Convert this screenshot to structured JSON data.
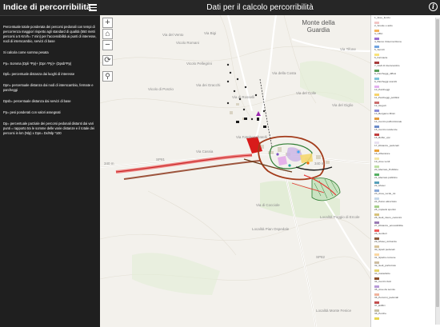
{
  "left_panel": {
    "title": "Indice di percorribilità",
    "paragraphs": [
      "Percentuale totale ponderata dei percorsi pedonali con tempi di percorrenza maggiori rispetto agli standard di qualità (550 metri percorsi a 5 Km/h= 7 min) per l'accessibilità ai punti di interesse, nodi di interscambio, servizi di base",
      "Si calcola come somma pesata",
      "Pp= Somma (Dpli *Pp)+ (Dpn *Pp)+ (Dpsb*Pp)",
      "Dpli= percentuale distanza dai luoghi di interesse",
      "Dpn= percentuale distanza dai nodi di interscambio, fermate e parcheggi",
      "Dpsb= percentuale distanza dai servizi di base",
      "Pp= pesi ponderati con valori assegnati",
      "Dp= percentuale parziale dei percorsi pedonali distanti dai vari punti = rapporto tra le somme delle varie distanze e il totale dei percorsi in km (Nlp) x Dpn= Dx/Nlp *100"
    ]
  },
  "header": {
    "title": "Dati per il calcolo percorribilità",
    "info_icon": "i"
  },
  "map": {
    "controls": {
      "zoom_in": "+",
      "home": "⌂",
      "zoom_out": "−",
      "refresh": "⟳",
      "search": "⚲"
    },
    "town_label": "Monte della Guardia",
    "labels": [
      "Via del Vento",
      "Vicolo Romani",
      "Via Bigi",
      "Vicolo Pellegrini",
      "Vicolo di Ponzio",
      "Via dei Gracchi",
      "Via di Rosselli",
      "Via della Costa",
      "Via del Colle",
      "Via del Giglio",
      "Via Tifone",
      "Via Cassia",
      "SP81",
      "340 m",
      "Via Fatebenefratelli",
      "Via di Cocciole",
      "340 m",
      "SP82",
      "Località Poggio di Ercole",
      "Località Monte Fenice",
      "Località Pian Ospedale"
    ]
  },
  "legend": {
    "items": [
      {
        "label": "1_Aree_funzio",
        "color": "#f2c6c6"
      },
      {
        "label": "2_Scuole e asilo",
        "color": "#f5b35b"
      },
      {
        "label": "3_Uffici",
        "color": "#9b6fd0"
      },
      {
        "label": "4_Banco Cisterna Roma",
        "color": "#6fa3e0"
      },
      {
        "label": "5_Servizi",
        "color": "#f8e27a"
      },
      {
        "label": "6_Farmacie",
        "color": "#a63c3c"
      },
      {
        "label": "7_Nodi di interscambio",
        "color": "#5a9e5a"
      },
      {
        "label": "8_Parcheggi_diffusi",
        "color": "#7fc3d9"
      },
      {
        "label": "9_Parcheggi scambi",
        "color": "#e4b0f0"
      },
      {
        "label": "10_Parcheggi",
        "color": "#f7d36b"
      },
      {
        "label": "11_Parcheggi_pubblici",
        "color": "#cb6e6e"
      },
      {
        "label": "12_Negozi",
        "color": "#8c8cd6"
      },
      {
        "label": "13_Bergamo Minni",
        "color": "#e49b3d"
      },
      {
        "label": "14_Centro polifunzionale",
        "color": "#6a8bc9"
      },
      {
        "label": "15_Centro residenze",
        "color": "#c13d3d"
      },
      {
        "label": "16_Buffer_cpc",
        "color": "#e8e0f0"
      },
      {
        "label": "17_Distanze_pedonali",
        "color": "#e9a23b"
      },
      {
        "label": "18_Alberature",
        "color": "#f1e5a6"
      },
      {
        "label": "19_Aree verdi",
        "color": "#bfe0a6"
      },
      {
        "label": "20_Mercato_Pubblico",
        "color": "#56b064"
      },
      {
        "label": "21_Mercato pubblico",
        "color": "#57a0b9"
      },
      {
        "label": "22_Musei",
        "color": "#8aa9d7"
      },
      {
        "label": "23_Area_verde_tot",
        "color": "#c5d7e8"
      },
      {
        "label": "24_Parco attrezzato",
        "color": "#a6cf8c"
      },
      {
        "label": "25_Impianti sportivi",
        "color": "#d7c27b"
      },
      {
        "label": "26_Sedi_intero_cammini",
        "color": "#9a7bb4"
      },
      {
        "label": "27_Distanze_accessibilita",
        "color": "#ee5b5b"
      },
      {
        "label": "28_Sentieri",
        "color": "#8c5b3b"
      },
      {
        "label": "29_Musei_vicinanze",
        "color": "#d8c49c"
      },
      {
        "label": "30_Spazi pedonali",
        "color": "#fad7a2"
      },
      {
        "label": "31_Spazio comune",
        "color": "#cdbda2"
      },
      {
        "label": "32_Sedi_porticciolo",
        "color": "#e4d36d"
      },
      {
        "label": "33_Castelletto",
        "color": "#8b4e2b"
      },
      {
        "label": "34_Centri civici",
        "color": "#b79ad8"
      },
      {
        "label": "35_Aree da servire",
        "color": "#f0b39c"
      },
      {
        "label": "36_Percorsi_pedonali",
        "color": "#c24f4f"
      },
      {
        "label": "37_Edifici",
        "color": "#c7c2a6"
      },
      {
        "label": "38_Perche",
        "color": "#e8d64f"
      }
    ]
  }
}
